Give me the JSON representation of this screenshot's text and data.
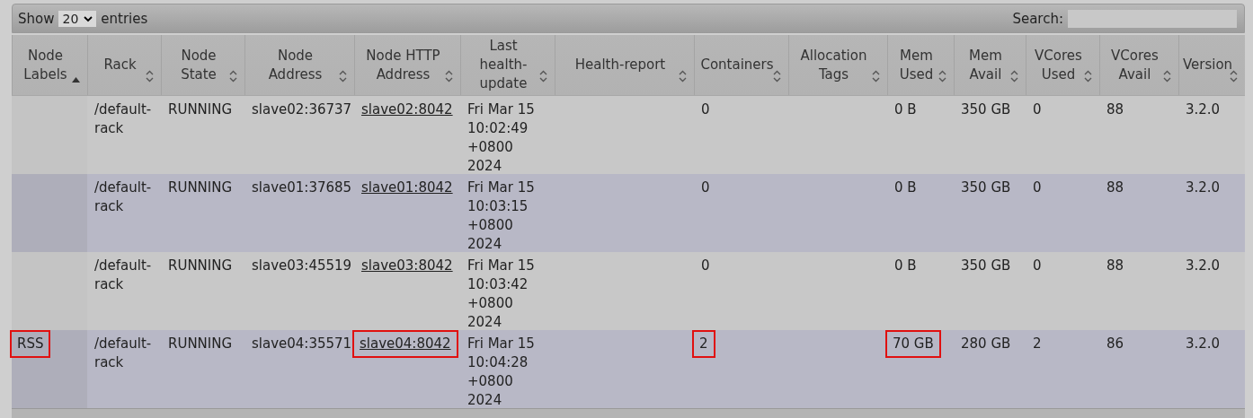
{
  "toolbar": {
    "show_label": "Show",
    "page_size": "20",
    "entries_label": "entries",
    "search_label": "Search:"
  },
  "table": {
    "columns": [
      {
        "label": "Node Labels",
        "sorted": true
      },
      {
        "label": "Rack",
        "sorted": false
      },
      {
        "label": "Node State",
        "sorted": false
      },
      {
        "label": "Node Address",
        "sorted": false
      },
      {
        "label": "Node HTTP Address",
        "sorted": false
      },
      {
        "label": "Last health-update",
        "sorted": false
      },
      {
        "label": "Health-report",
        "sorted": false
      },
      {
        "label": "Containers",
        "sorted": false
      },
      {
        "label": "Allocation Tags",
        "sorted": false
      },
      {
        "label": "Mem Used",
        "sorted": false
      },
      {
        "label": "Mem Avail",
        "sorted": false
      },
      {
        "label": "VCores Used",
        "sorted": false
      },
      {
        "label": "VCores Avail",
        "sorted": false
      },
      {
        "label": "Version",
        "sorted": false
      }
    ],
    "rows": [
      {
        "rack": {
          "text": "/default-rack",
          "highlighted": false
        },
        "node_state": {
          "text": "RUNNING",
          "highlighted": false
        },
        "node_address": {
          "text": "slave02:36737",
          "highlighted": false
        },
        "node_http_address": {
          "text": "slave02:8042",
          "highlighted": false
        },
        "last_health_update": {
          "text": "Fri Mar 15 10:02:49 +0800 2024",
          "highlighted": false
        },
        "containers": {
          "text": "0",
          "highlighted": false
        },
        "mem_used": {
          "text": "0 B",
          "highlighted": false
        },
        "mem_avail": {
          "text": "350 GB",
          "highlighted": false
        },
        "vcores_used": {
          "text": "0",
          "highlighted": false
        },
        "vcores_avail": {
          "text": "88",
          "highlighted": false
        },
        "version": {
          "text": "3.2.0",
          "highlighted": false
        }
      },
      {
        "rack": {
          "text": "/default-rack",
          "highlighted": false
        },
        "node_state": {
          "text": "RUNNING",
          "highlighted": false
        },
        "node_address": {
          "text": "slave01:37685",
          "highlighted": false
        },
        "node_http_address": {
          "text": "slave01:8042",
          "highlighted": false
        },
        "last_health_update": {
          "text": "Fri Mar 15 10:03:15 +0800 2024",
          "highlighted": false
        },
        "containers": {
          "text": "0",
          "highlighted": false
        },
        "mem_used": {
          "text": "0 B",
          "highlighted": false
        },
        "mem_avail": {
          "text": "350 GB",
          "highlighted": false
        },
        "vcores_used": {
          "text": "0",
          "highlighted": false
        },
        "vcores_avail": {
          "text": "88",
          "highlighted": false
        },
        "version": {
          "text": "3.2.0",
          "highlighted": false
        }
      },
      {
        "rack": {
          "text": "/default-rack",
          "highlighted": false
        },
        "node_state": {
          "text": "RUNNING",
          "highlighted": false
        },
        "node_address": {
          "text": "slave03:45519",
          "highlighted": false
        },
        "node_http_address": {
          "text": "slave03:8042",
          "highlighted": false
        },
        "last_health_update": {
          "text": "Fri Mar 15 10:03:42 +0800 2024",
          "highlighted": false
        },
        "containers": {
          "text": "0",
          "highlighted": false
        },
        "mem_used": {
          "text": "0 B",
          "highlighted": false
        },
        "mem_avail": {
          "text": "350 GB",
          "highlighted": false
        },
        "vcores_used": {
          "text": "0",
          "highlighted": false
        },
        "vcores_avail": {
          "text": "88",
          "highlighted": false
        },
        "version": {
          "text": "3.2.0",
          "highlighted": false
        }
      },
      {
        "node_labels": {
          "text": "RSS",
          "highlighted": true
        },
        "rack": {
          "text": "/default-rack",
          "highlighted": false
        },
        "node_state": {
          "text": "RUNNING",
          "highlighted": false
        },
        "node_address": {
          "text": "slave04:35571",
          "highlighted": false
        },
        "node_http_address": {
          "text": "slave04:8042",
          "highlighted": true
        },
        "last_health_update": {
          "text": "Fri Mar 15 10:04:28 +0800 2024",
          "highlighted": false
        },
        "containers": {
          "text": "2",
          "highlighted": true
        },
        "mem_used": {
          "text": "70 GB",
          "highlighted": true
        },
        "mem_avail": {
          "text": "280 GB",
          "highlighted": false
        },
        "vcores_used": {
          "text": "2",
          "highlighted": false
        },
        "vcores_avail": {
          "text": "86",
          "highlighted": false
        },
        "version": {
          "text": "3.2.0",
          "highlighted": false
        }
      }
    ]
  }
}
